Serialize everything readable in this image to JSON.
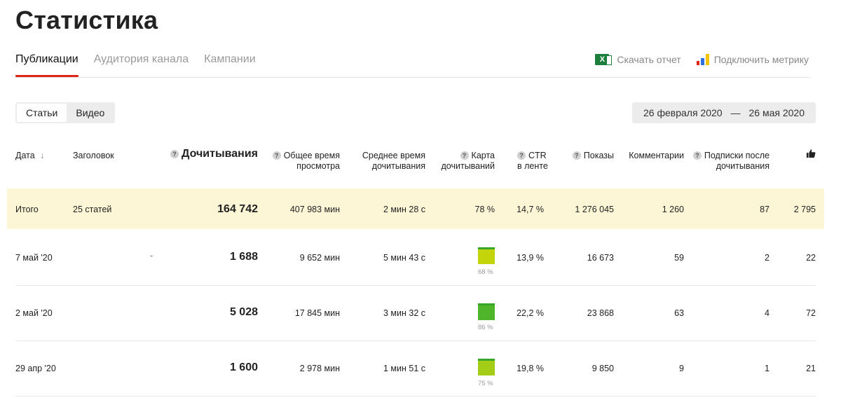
{
  "page": {
    "title": "Статистика"
  },
  "tabs": [
    {
      "label": "Публикации",
      "active": true
    },
    {
      "label": "Аудитория канала",
      "active": false
    },
    {
      "label": "Кампании",
      "active": false
    }
  ],
  "actions": {
    "download": "Скачать отчет",
    "metrika": "Подключить метрику",
    "excel_glyph": "X"
  },
  "content_type": [
    {
      "label": "Статьи",
      "active": true
    },
    {
      "label": "Видео",
      "active": false
    }
  ],
  "date_range": {
    "from": "26 февраля 2020",
    "separator": "—",
    "to": "26 мая 2020"
  },
  "table": {
    "headers": {
      "date": "Дата",
      "sort_arrow": "↓",
      "title": "Заголовок",
      "reads": "Дочитывания",
      "total_time_1": "Общее время",
      "total_time_2": "просмотра",
      "avg_time_1": "Среднее время",
      "avg_time_2": "дочитывания",
      "map_1": "Карта",
      "map_2": "дочитываний",
      "ctr_1": "CTR",
      "ctr_2": "в ленте",
      "views": "Показы",
      "comments": "Комментарии",
      "subs_1": "Подписки после",
      "subs_2": "дочитывания",
      "help": "?"
    },
    "total": {
      "label": "Итого",
      "title": "25 статей",
      "reads": "164 742",
      "total_time": "407 983 мин",
      "avg_time": "2 мин 28 с",
      "map": "78 %",
      "ctr": "14,7 %",
      "views": "1 276 045",
      "comments": "1 260",
      "subs": "87",
      "likes": "2 795"
    },
    "rows": [
      {
        "date": "7 май '20",
        "title": "-",
        "reads": "1 688",
        "total_time": "9 652 мин",
        "avg_time": "5 мин 43 с",
        "map": "68 %",
        "map_value": 0.68,
        "map_color": "#c3d40b",
        "ctr": "13,9 %",
        "views": "16 673",
        "comments": "59",
        "subs": "2",
        "likes": "22"
      },
      {
        "date": "2 май '20",
        "title": "",
        "reads": "5 028",
        "total_time": "17 845 мин",
        "avg_time": "3 мин 32 с",
        "map": "86 %",
        "map_value": 0.86,
        "map_color": "#4fb52a",
        "ctr": "22,2 %",
        "views": "23 868",
        "comments": "63",
        "subs": "4",
        "likes": "72"
      },
      {
        "date": "29 апр '20",
        "title": "",
        "reads": "1 600",
        "total_time": "2 978 мин",
        "avg_time": "1 мин 51 с",
        "map": "75 %",
        "map_value": 0.75,
        "map_color": "#a3cd17",
        "ctr": "19,8 %",
        "views": "9 850",
        "comments": "9",
        "subs": "1",
        "likes": "21"
      }
    ]
  },
  "colors": {
    "accent": "#e0251a",
    "total_bg": "#fcf6d6",
    "excel": "#1e7e3e"
  }
}
